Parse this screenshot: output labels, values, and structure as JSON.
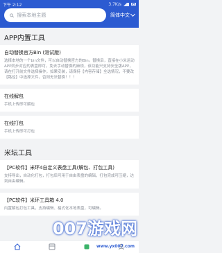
{
  "status_bar": {
    "time": "下午 2:12",
    "network": "3.7K/s"
  },
  "search": {
    "placeholder": "搜索本地主题"
  },
  "header": {
    "language": "简体中文"
  },
  "sections": [
    {
      "title": "APP内置工具",
      "cards": [
        {
          "title": "自动替换官方Bin (测试版)",
          "desc": "选择本地的一个bin文件，可以自动替换官方的Bin。替换后，直接在小米运动APP同步对应的表盘即可，免去手动替换的麻烦，该功能只支持安全版APP，请在打开前文件选择操作，如果安装，请保持【内容存储】全选情况，不要改【路径】中选择文件，否则无法替换！！！"
        },
        {
          "title": "在线解包",
          "desc": "手机上传即可解包"
        },
        {
          "title": "在线打包",
          "desc": "手机上传即可打包"
        }
      ]
    },
    {
      "title": "米坛工具",
      "cards": [
        {
          "title": "【PC软件】米环4自定义表盘工具(解包、打包工具)",
          "desc": "支持导出，自动化打包，打包后可用于自由表盘的编辑，打包完成可压缩，达到自由编辑。"
        },
        {
          "title": "【PC软件】米环工具箱 4.0",
          "desc": "内置解包打包工具，支持编辑、格式化本地表盘，可编辑。"
        }
      ]
    }
  ],
  "bottom_nav": [
    "home-icon",
    "grid-icon",
    "tools-icon",
    "user-icon"
  ],
  "watermark": {
    "text": "007游戏网",
    "url": "www.yx007.com"
  },
  "colors": {
    "accent": "#2c5bd1",
    "background": "#f2f3f5"
  }
}
